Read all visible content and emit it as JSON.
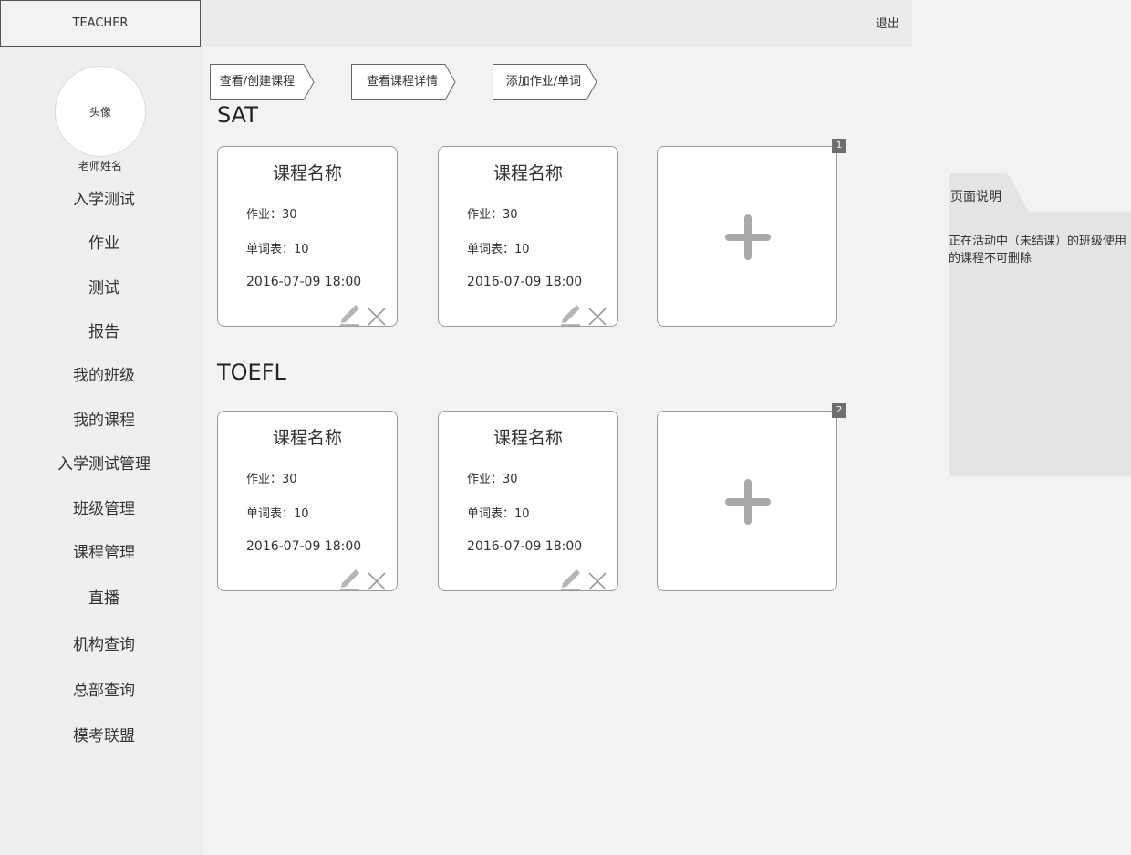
{
  "brand": {
    "label": "TEACHER"
  },
  "header": {
    "logout_label": "退出"
  },
  "profile": {
    "avatar_label": "头像",
    "teacher_name": "老师姓名"
  },
  "sidebar": {
    "items": [
      {
        "label": "入学测试"
      },
      {
        "label": "作业"
      },
      {
        "label": "测试"
      },
      {
        "label": "报告"
      },
      {
        "label": "我的班级"
      },
      {
        "label": "我的课程"
      },
      {
        "label": "入学测试管理"
      },
      {
        "label": "班级管理"
      },
      {
        "label": "课程管理"
      },
      {
        "label": "直播"
      },
      {
        "label": "机构查询"
      },
      {
        "label": "总部查询"
      },
      {
        "label": "模考联盟"
      }
    ]
  },
  "steps": [
    {
      "label": "查看/创建课程"
    },
    {
      "label": "查看课程详情"
    },
    {
      "label": "添加作业/单词"
    }
  ],
  "sections": [
    {
      "title": "SAT",
      "badge": "1",
      "cards": [
        {
          "title": "课程名称",
          "homework": "作业：30",
          "wordlist": "单词表：10",
          "datetime": "2016-07-09  18:00"
        },
        {
          "title": "课程名称",
          "homework": "作业：30",
          "wordlist": "单词表：10",
          "datetime": "2016-07-09  18:00"
        }
      ]
    },
    {
      "title": "TOEFL",
      "badge": "2",
      "cards": [
        {
          "title": "课程名称",
          "homework": "作业：30",
          "wordlist": "单词表：10",
          "datetime": "2016-07-09  18:00"
        },
        {
          "title": "课程名称",
          "homework": "作业：30",
          "wordlist": "单词表：10",
          "datetime": "2016-07-09  18:00"
        }
      ]
    }
  ],
  "icons": {
    "edit": "pencil-icon",
    "delete": "close-icon",
    "add": "plus-icon"
  },
  "page_note": {
    "title": "页面说明",
    "text": "正在活动中（未结课）的班级使用的课程不可删除"
  }
}
